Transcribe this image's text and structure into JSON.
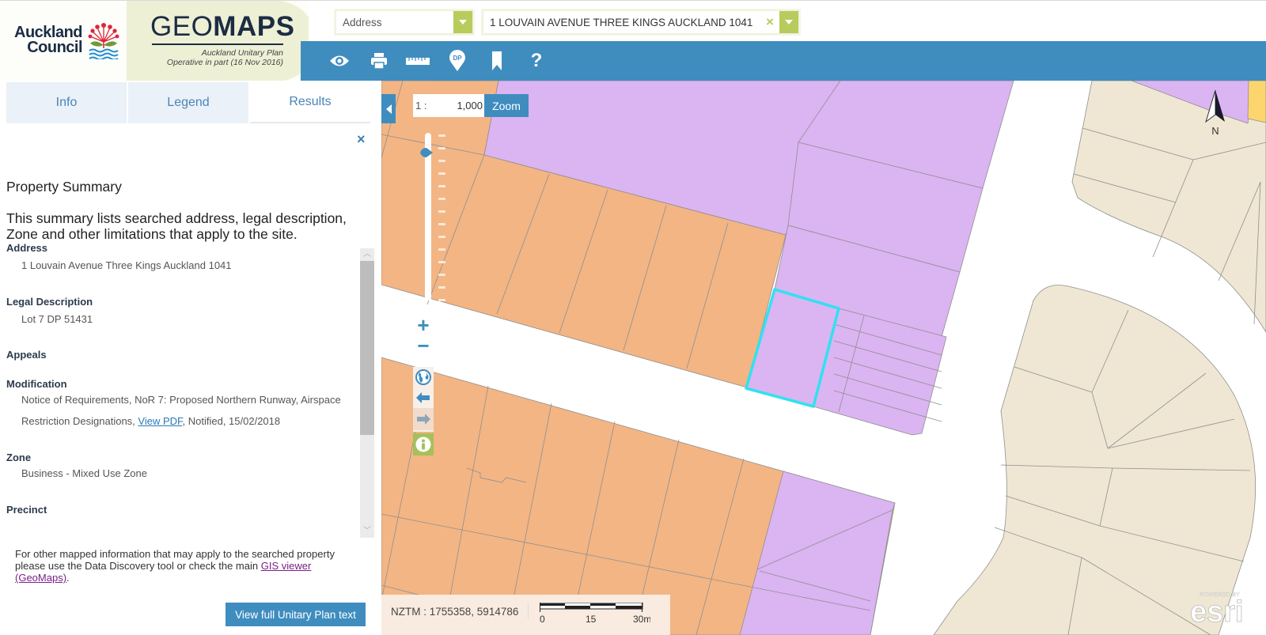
{
  "brand": {
    "council_line1": "Auckland",
    "council_line2": "Council",
    "title_light": "GEO",
    "title_bold": "MAPS",
    "subtitle_line1": "Auckland Unitary Plan",
    "subtitle_line2": "Operative in part (16 Nov 2016)"
  },
  "search": {
    "type_value": "Address",
    "address_value": "1 LOUVAIN AVENUE THREE KINGS AUCKLAND 1041",
    "clear_icon": "×"
  },
  "toolbar": {
    "tools": [
      {
        "name": "visibility",
        "icon": "eye-icon"
      },
      {
        "name": "print",
        "icon": "printer-icon"
      },
      {
        "name": "measure",
        "icon": "ruler-icon"
      },
      {
        "name": "dp-marker",
        "icon": "dp-pin-icon",
        "label": "DP"
      },
      {
        "name": "bookmark",
        "icon": "bookmark-icon"
      },
      {
        "name": "help",
        "icon": "question-icon",
        "label": "?"
      }
    ]
  },
  "panel": {
    "tabs": [
      {
        "label": "Info",
        "active": false
      },
      {
        "label": "Legend",
        "active": false
      },
      {
        "label": "Results",
        "active": true
      }
    ],
    "close_icon": "×",
    "title": "Property Summary",
    "description": "This summary lists searched address, legal description, Zone and other limitations that apply to the site.",
    "sections": {
      "address": {
        "heading": "Address",
        "value": "1 Louvain Avenue Three Kings Auckland 1041"
      },
      "legal": {
        "heading": "Legal Description",
        "value": "Lot 7 DP 51431"
      },
      "appeals": {
        "heading": "Appeals"
      },
      "modification": {
        "heading": "Modification",
        "line1": "Notice of Requirements, NoR 7: Proposed Northern Runway, Airspace",
        "line2_prefix": "Restriction Designations, ",
        "link": "View PDF",
        "line2_suffix": ", Notified, 15/02/2018"
      },
      "zone": {
        "heading": "Zone",
        "value": "Business - Mixed Use Zone"
      },
      "precinct": {
        "heading": "Precinct"
      }
    },
    "scrollbar": {
      "position_fraction": 0.0,
      "visible_fraction": 0.66
    },
    "footer": {
      "text": "For other mapped information that may apply to the searched property please use the Data Discovery tool or check the main ",
      "link": "GIS viewer (GeoMaps)",
      "end": "."
    },
    "full_text_button": "View full Unitary Plan text"
  },
  "map": {
    "scale_prefix": "1 :",
    "scale_value": "1,000",
    "zoom_button": "Zoom",
    "zoom_slider_level_fraction": 0.12,
    "nav": {
      "plus": "+",
      "minus": "−"
    },
    "coords_label": "NZTM : 1755358, 5914786",
    "scalebar_labels": [
      "0",
      "15",
      "30m"
    ],
    "north_label": "N",
    "esri_powered": "POWERED BY",
    "esri_name": "esri",
    "colors": {
      "mixed_use_zone": "#f3b584",
      "business_zone": "#dbb4f2",
      "residential_zone": "#efe7d3",
      "yellow_zone": "#fdd56f",
      "selected_outline": "#2fe2ef",
      "parcel_line": "#8f8f8f",
      "accent_blue": "#3f8dbf",
      "accent_green": "#b7cc5c"
    }
  }
}
